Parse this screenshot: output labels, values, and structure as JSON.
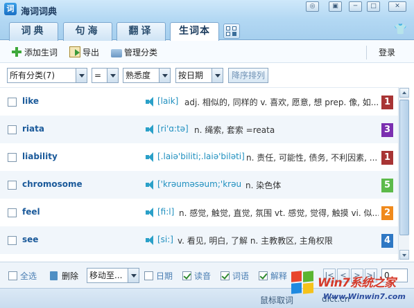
{
  "window": {
    "logo": "词",
    "title": "海词词典",
    "controls": [
      "◎",
      "▣",
      "─",
      "□",
      "✕"
    ]
  },
  "tabs": [
    {
      "label": "词典",
      "active": false
    },
    {
      "label": "句海",
      "active": false
    },
    {
      "label": "翻译",
      "active": false
    },
    {
      "label": "生词本",
      "active": true
    }
  ],
  "toolbar": {
    "add_label": "添加生词",
    "export_label": "导出",
    "manage_label": "管理分类",
    "login_label": "登录"
  },
  "filters": {
    "category": "所有分类(7)",
    "operator": "=",
    "familiarity": "熟悉度",
    "sort_by": "按日期",
    "sort_order_label": "降序排列"
  },
  "words": [
    {
      "word": "like",
      "phonetic": "[laik]",
      "meaning": "adj. 相似的, 同样的 v. 喜欢, 愿意, 想 prep. 像, 如...",
      "level": "1",
      "color": "#a83434"
    },
    {
      "word": "riata",
      "phonetic": "[ri'ɑ:tə]",
      "meaning": "n. 绳索, 套索 =reata",
      "level": "3",
      "color": "#7b2fb0"
    },
    {
      "word": "liability",
      "phonetic": "[.laiə'biliti;.laiə'biləti]",
      "meaning": "n. 责任, 可能性, 债务, 不利因素, ...",
      "level": "1",
      "color": "#a83434"
    },
    {
      "word": "chromosome",
      "phonetic": "['krəuməsəum;'krəu",
      "meaning": "n. 染色体",
      "level": "5",
      "color": "#5cba4a"
    },
    {
      "word": "feel",
      "phonetic": "[fi:l]",
      "meaning": "n. 感觉, 触觉, 直觉, 氛围 vt. 感觉, 觉得, 触摸 vi. 似...",
      "level": "2",
      "color": "#f08a1c"
    },
    {
      "word": "see",
      "phonetic": "[si:]",
      "meaning": "v. 看见, 明白, 了解 n. 主教教区, 主角权限",
      "level": "4",
      "color": "#2f78c4"
    }
  ],
  "bottom": {
    "select_all": "全选",
    "delete": "删除",
    "move_to": "移动至...",
    "date": "日期",
    "pronunciation": "读音",
    "entry": "词语",
    "explanation": "解释",
    "page": "0",
    "pager_buttons": [
      "|<",
      "<",
      ">",
      ">|"
    ]
  },
  "status": {
    "hint": "鼠标取词",
    "site": "dict.cn"
  },
  "watermark": {
    "brand": "Win7系统之家",
    "url": "Www.Winwin7.com"
  }
}
